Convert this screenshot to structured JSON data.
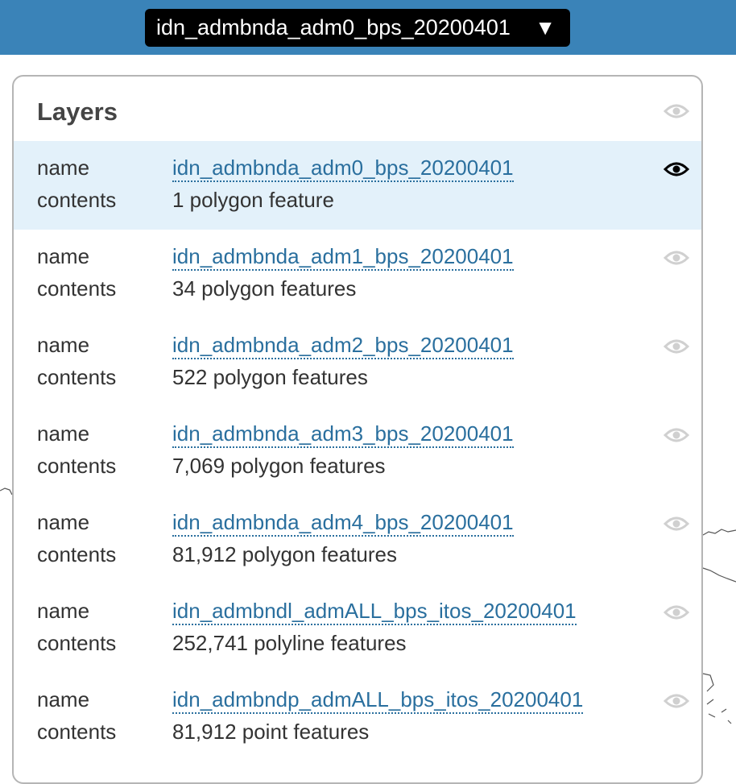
{
  "header": {
    "dataset_select": "idn_admbnda_adm0_bps_20200401",
    "caret": "▼"
  },
  "layers_panel": {
    "title": "Layers",
    "label_name": "name",
    "label_contents": "contents",
    "items": [
      {
        "name": "idn_admbnda_adm0_bps_20200401",
        "contents": "1 polygon feature",
        "visible": true,
        "selected": true
      },
      {
        "name": "idn_admbnda_adm1_bps_20200401",
        "contents": "34 polygon features",
        "visible": false,
        "selected": false
      },
      {
        "name": "idn_admbnda_adm2_bps_20200401",
        "contents": "522 polygon features",
        "visible": false,
        "selected": false
      },
      {
        "name": "idn_admbnda_adm3_bps_20200401",
        "contents": "7,069 polygon features",
        "visible": false,
        "selected": false
      },
      {
        "name": "idn_admbnda_adm4_bps_20200401",
        "contents": "81,912 polygon features",
        "visible": false,
        "selected": false
      },
      {
        "name": "idn_admbndl_admALL_bps_itos_20200401",
        "contents": "252,741 polyline features",
        "visible": false,
        "selected": false
      },
      {
        "name": "idn_admbndp_admALL_bps_itos_20200401",
        "contents": "81,912 point features",
        "visible": false,
        "selected": false
      }
    ]
  },
  "colors": {
    "topbar": "#3a83b8",
    "link": "#2a6f9e",
    "selected_row": "#e3f1fa",
    "eye_on": "#000000",
    "eye_off": "#d0d0d0"
  },
  "icons": {
    "dataset_caret": "triangle-down-icon",
    "visibility": "eye-icon"
  }
}
